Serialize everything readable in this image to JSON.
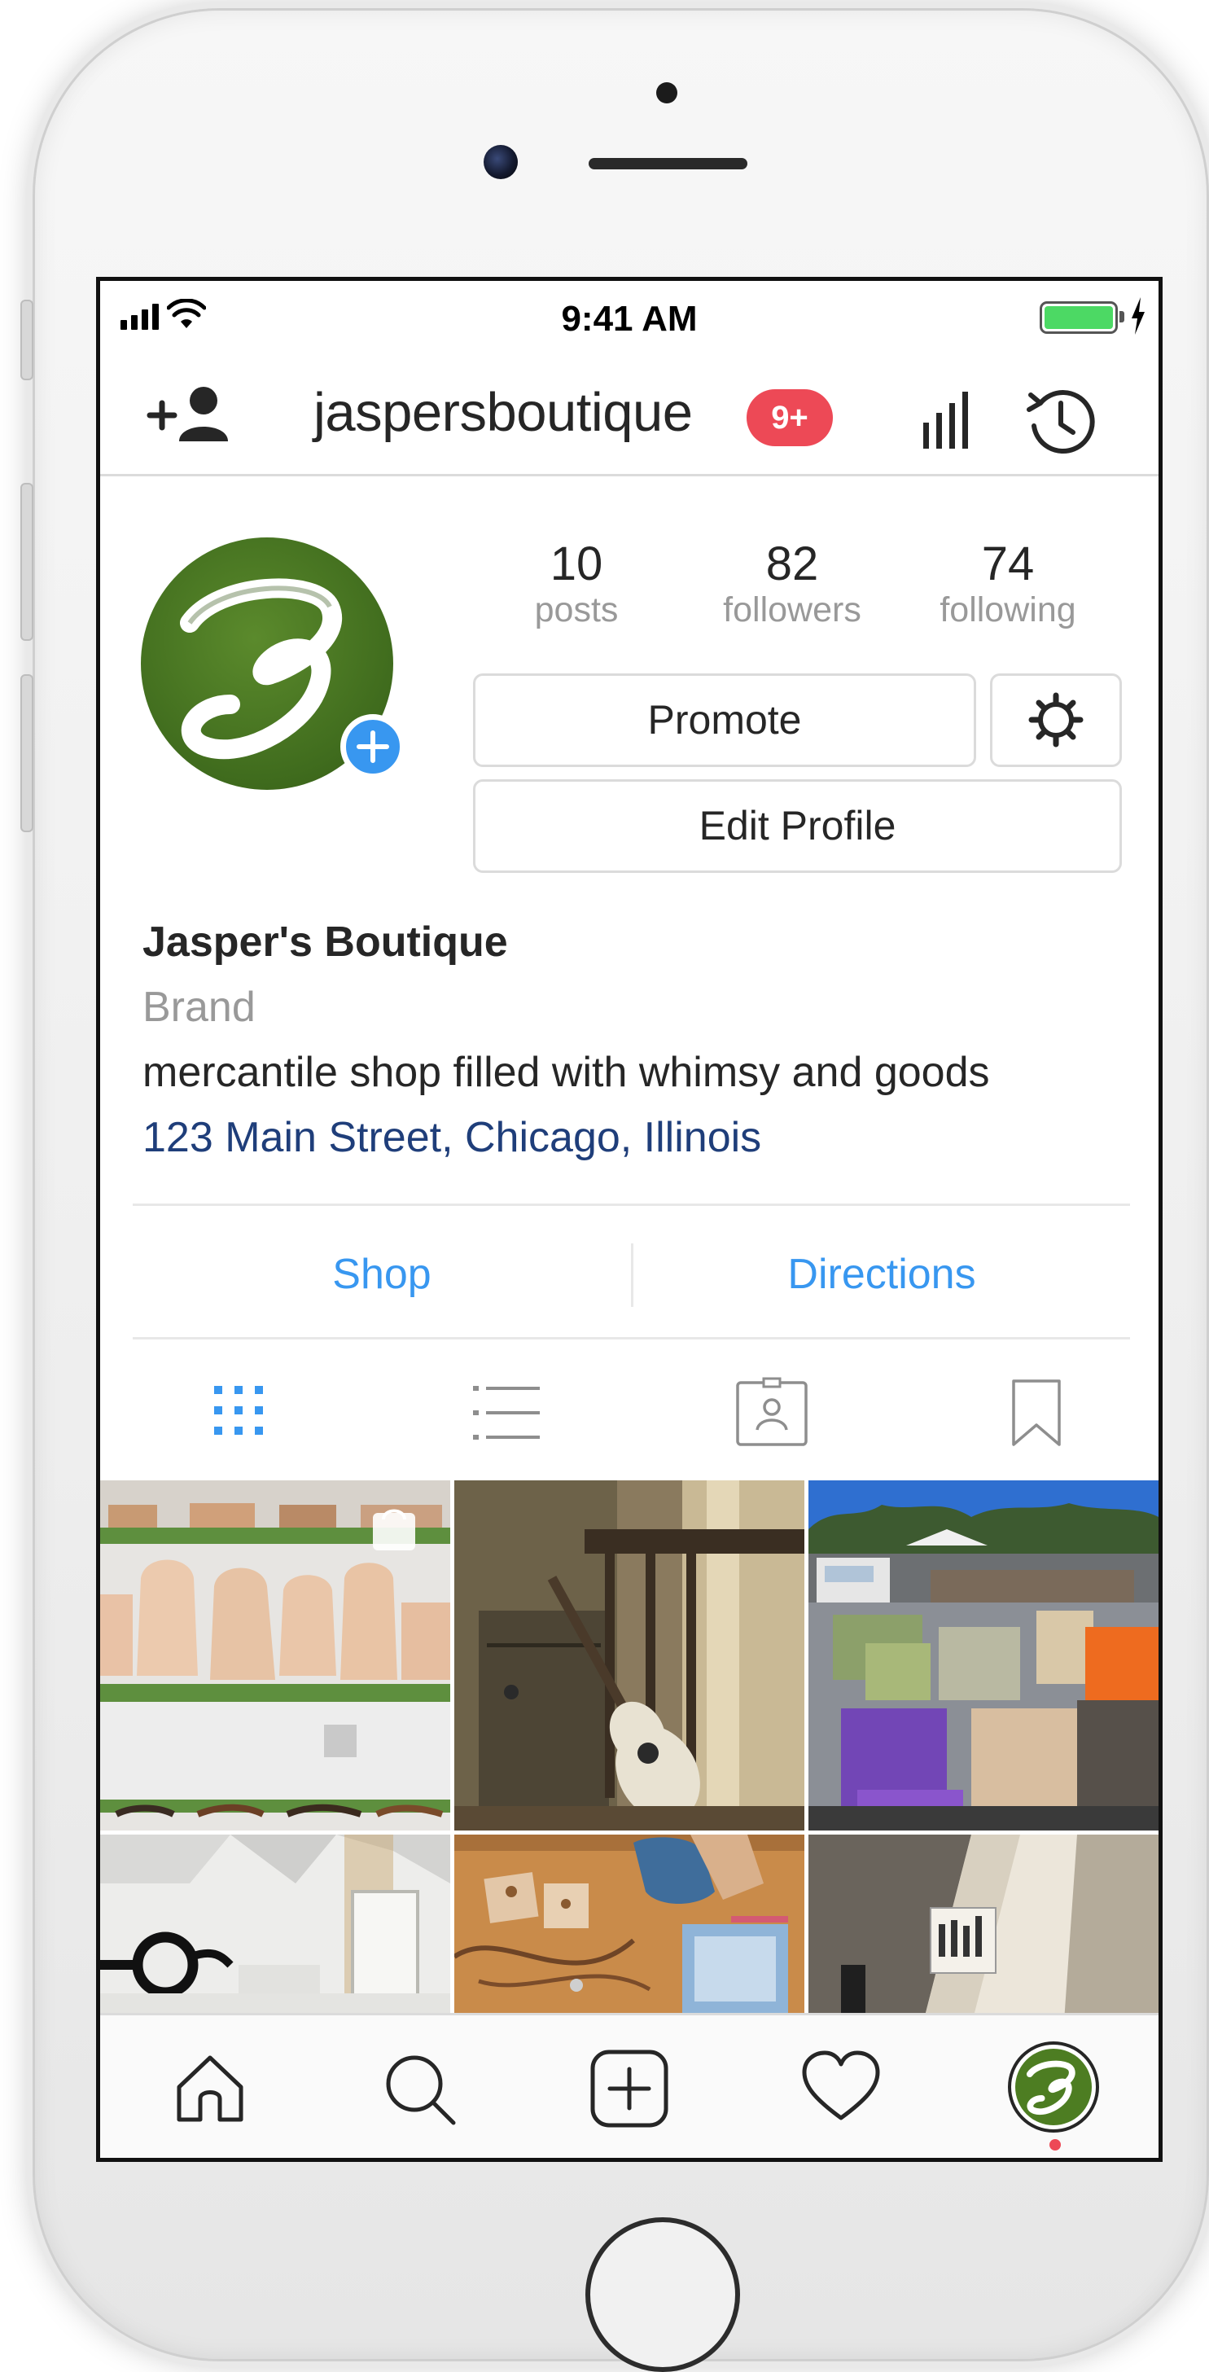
{
  "status_bar": {
    "time": "9:41 AM",
    "battery_color": "#4cd964"
  },
  "nav": {
    "username": "jaspersboutique",
    "notification_badge": "9+",
    "badge_color": "#ed4956"
  },
  "profile": {
    "stats": [
      {
        "value": "10",
        "label": "posts"
      },
      {
        "value": "82",
        "label": "followers"
      },
      {
        "value": "74",
        "label": "following"
      }
    ],
    "promote_label": "Promote",
    "edit_profile_label": "Edit Profile",
    "display_name": "Jasper's Boutique",
    "category": "Brand",
    "bio": "mercantile shop filled with whimsy and goods",
    "address": "123 Main Street, Chicago, Illinois"
  },
  "contact": {
    "shop_label": "Shop",
    "directions_label": "Directions",
    "link_color": "#3897f0"
  },
  "profile_tabs": [
    "grid-view-icon",
    "list-view-icon",
    "tagged-icon",
    "saved-bookmark-icon"
  ],
  "grid_posts": [
    "shelves-leather-bags-photo",
    "guitar-chair-photo",
    "outdoor-flea-market-chairs-photo",
    "eyeglasses-wall-photo",
    "leather-goods-workbench-photo",
    "sunlit-wall-photo"
  ],
  "bottom_tabs": [
    "home-icon",
    "search-icon",
    "new-post-icon",
    "activity-heart-icon",
    "profile-avatar-icon"
  ],
  "accent_color": "#3897f0"
}
